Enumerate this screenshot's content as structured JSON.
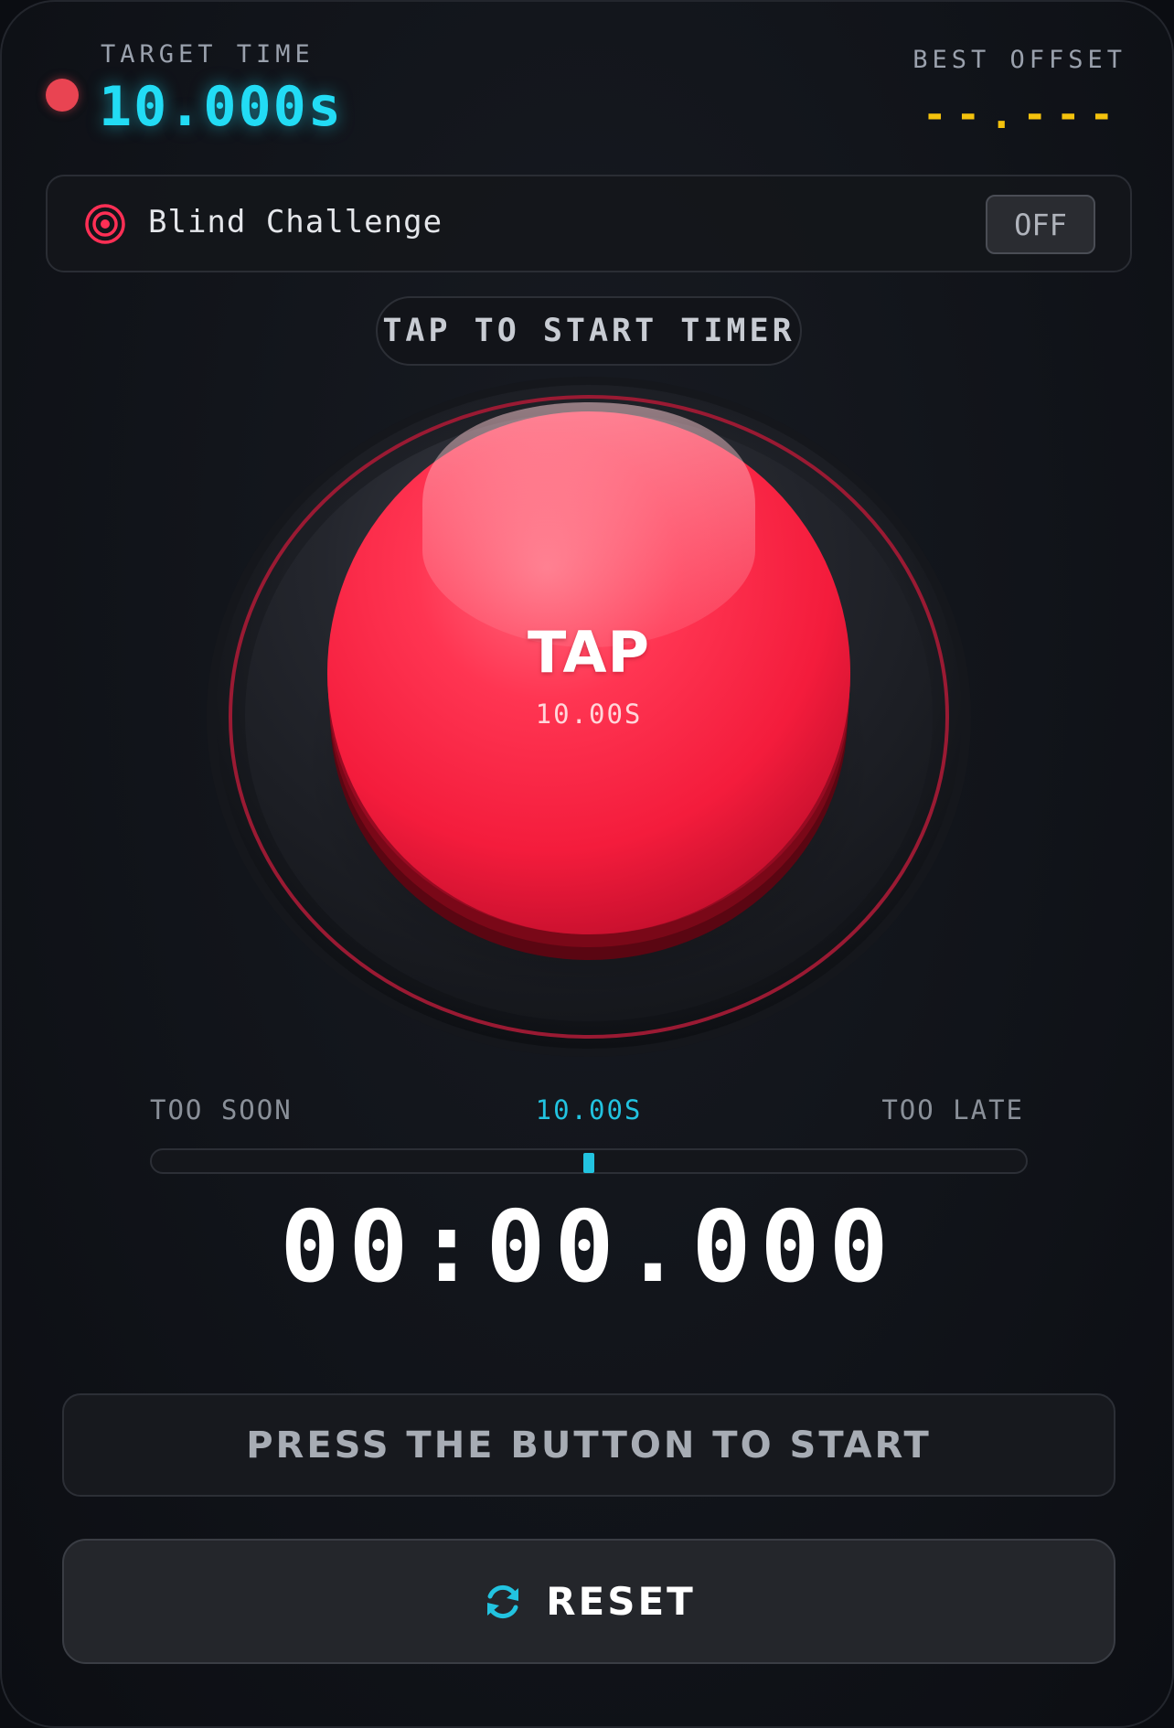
{
  "header": {
    "target_label": "TARGET TIME",
    "target_value": "10.000s",
    "best_label": "BEST OFFSET",
    "best_value": "--.---"
  },
  "blind_challenge": {
    "label": "Blind Challenge",
    "toggle_label": "OFF",
    "icon": "target-icon"
  },
  "start_hint": "TAP TO START TIMER",
  "big_button": {
    "label": "TAP",
    "sublabel": "10.00S"
  },
  "gauge": {
    "left_label": "TOO SOON",
    "center_label": "10.00S",
    "right_label": "TOO LATE",
    "marker_fraction": 0.5
  },
  "clock": "00:00.000",
  "status": "PRESS THE BUTTON TO START",
  "reset": {
    "label": "RESET",
    "icon": "refresh-icon"
  },
  "colors": {
    "accent_cyan": "#22dcf5",
    "best_yellow": "#f4c20d",
    "button_red": "#ff1e42",
    "record_dot": "#e94452"
  }
}
